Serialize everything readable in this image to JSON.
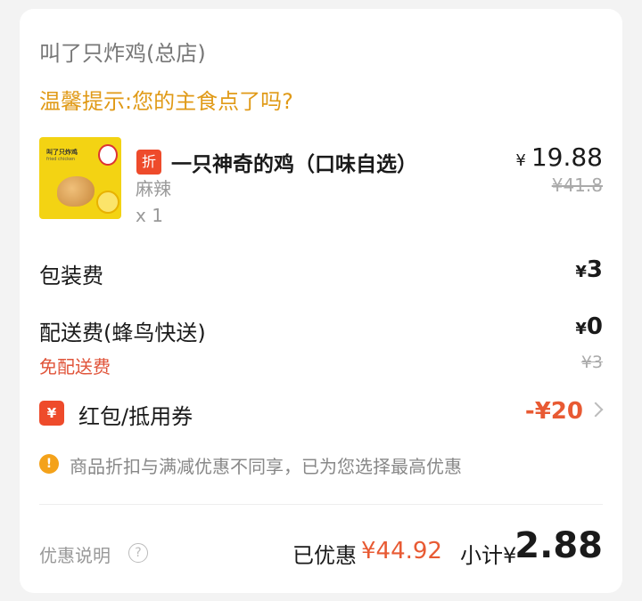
{
  "shop": {
    "name": "叫了只炸鸡(总店)"
  },
  "tip": "温馨提示:您的主食点了吗?",
  "item": {
    "badge": "折",
    "name": "一只神奇的鸡（口味自选）",
    "currency": "¥",
    "price": "19.88",
    "original_price": "¥41.8",
    "spec": "麻辣",
    "qty": "x 1",
    "thumb_brand": "叫了只炸鸡",
    "thumb_sub": "fried chicken"
  },
  "packaging": {
    "label": "包装费",
    "currency": "¥",
    "value": "3"
  },
  "delivery": {
    "label": "配送费(蜂鸟快送)",
    "currency": "¥",
    "value": "0",
    "free_label": "免配送费",
    "original": "¥3"
  },
  "coupon": {
    "badge": "¥",
    "label": "红包/抵用券",
    "value": "-¥20"
  },
  "notice": {
    "icon": "!",
    "text": "商品折扣与满减优惠不同享，已为您选择最高优惠"
  },
  "footer": {
    "explain_label": "优惠说明",
    "help_icon": "?",
    "saved_label": "已优惠",
    "saved_value": "¥44.92",
    "subtotal_label": "小计¥",
    "subtotal_value": "2.88"
  },
  "colors": {
    "accent": "#e85a33",
    "tip": "#e09a17",
    "badge": "#ee4b2b"
  }
}
